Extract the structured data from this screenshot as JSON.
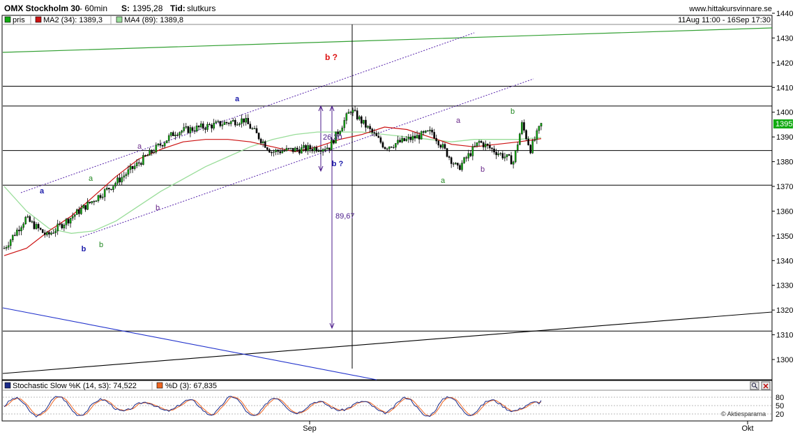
{
  "header": {
    "title": "OMX Stockholm 30",
    "interval_text": "- 60min",
    "s_label": "S:",
    "s_value": "1395,28",
    "tid_label": "Tid:",
    "tid_value": "slutkurs",
    "site": "www.hittakursvinnare.se"
  },
  "legend": {
    "items": [
      {
        "label": "pris",
        "color": "#11aa11"
      },
      {
        "label": "MA2 (34): 1389,3",
        "color": "#cc1111"
      },
      {
        "label": "MA4 (89): 1389,8",
        "color": "#99dd99"
      }
    ],
    "date_range": "11Aug 11:00 - 16Sep 17:30"
  },
  "price_axis": {
    "ticks": [
      "1440",
      "1430",
      "1420",
      "1410",
      "1400",
      "1390",
      "1380",
      "1370",
      "1360",
      "1350",
      "1340",
      "1330",
      "1320",
      "1310",
      "1300"
    ],
    "last_value": "1395"
  },
  "x_axis": {
    "ticks": [
      "Sep",
      "Okt"
    ]
  },
  "stochastic": {
    "k_label": "Stochastic Slow %K (14, s3): 74,522",
    "d_label": "%D (3): 67,835",
    "k_color": "#1a2a88",
    "d_color": "#ee6622",
    "ticks": [
      "80",
      "50",
      "20"
    ],
    "credit": "© Aktiespararna"
  },
  "annotations": {
    "wave_labels": [
      "a",
      "b",
      "a",
      "b",
      "a",
      "b",
      "a",
      "b ?",
      "b ?",
      "a",
      "b",
      "a",
      "b"
    ],
    "measure_small": "26,30",
    "measure_big": "89,67"
  },
  "chart_data": {
    "type": "candlestick",
    "title": "OMX Stockholm 30",
    "y_range": [
      1290,
      1442
    ],
    "x_range_text": "11Aug 11:00 - 16Sep 17:30",
    "last_close": 1395.28,
    "horizontal_levels": [
      1410.5,
      1402.5,
      1384.5,
      1370.5,
      1311.5
    ],
    "key_turns": [
      {
        "bar": 0,
        "value": 1345
      },
      {
        "bar": 10,
        "value": 1357
      },
      {
        "bar": 20,
        "value": 1350
      },
      {
        "bar": 50,
        "value": 1370
      },
      {
        "bar": 80,
        "value": 1392
      },
      {
        "bar": 112,
        "value": 1397
      },
      {
        "bar": 125,
        "value": 1384
      },
      {
        "bar": 152,
        "value": 1386
      },
      {
        "bar": 162,
        "value": 1401
      },
      {
        "bar": 178,
        "value": 1386
      },
      {
        "bar": 200,
        "value": 1392
      },
      {
        "bar": 212,
        "value": 1377
      },
      {
        "bar": 222,
        "value": 1388
      },
      {
        "bar": 238,
        "value": 1380
      },
      {
        "bar": 242,
        "value": 1395
      },
      {
        "bar": 246,
        "value": 1385
      },
      {
        "bar": 251,
        "value": 1395
      }
    ],
    "ma2_34": [
      1342,
      1345,
      1352,
      1358,
      1366,
      1374,
      1381,
      1385,
      1388,
      1389,
      1389,
      1388,
      1386,
      1384,
      1386,
      1389,
      1391,
      1394,
      1393,
      1390,
      1387,
      1386,
      1387,
      1388,
      1389.3
    ],
    "ma4_89": [
      1370,
      1360,
      1353,
      1351,
      1352,
      1356,
      1362,
      1368,
      1373,
      1378,
      1382,
      1386,
      1389,
      1391,
      1392,
      1392,
      1392,
      1391,
      1390,
      1389,
      1388,
      1389,
      1389,
      1389,
      1389.8
    ],
    "stochastic_k_last": 74.522,
    "stochastic_d_last": 67.835
  }
}
